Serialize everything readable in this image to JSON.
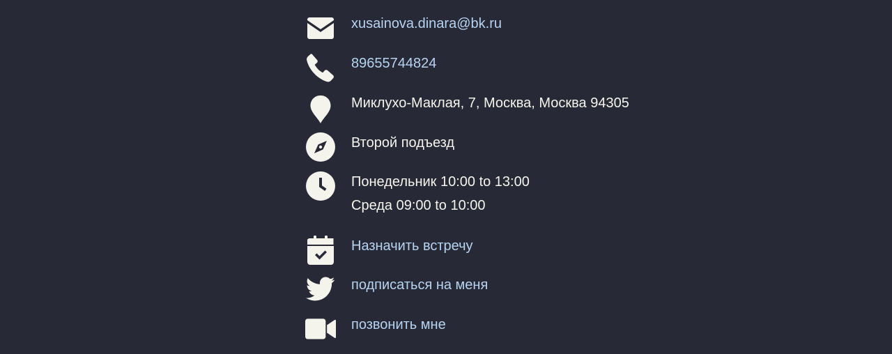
{
  "contact": {
    "email": {
      "icon": "envelope-icon",
      "value": "xusainova.dinara@bk.ru"
    },
    "phone": {
      "icon": "phone-icon",
      "value": "89655744824"
    },
    "address": {
      "icon": "map-pin-icon",
      "value": "Миклухо-Маклая, 7, Москва, Москва 94305"
    },
    "directions": {
      "icon": "compass-icon",
      "value": "Второй подъезд"
    },
    "hours": {
      "icon": "clock-icon",
      "lines": [
        "Понедельник 10:00 to 13:00",
        "Среда 09:00 to 10:00"
      ]
    },
    "appointment": {
      "icon": "calendar-check-icon",
      "label": "Назначить встречу"
    },
    "twitter": {
      "icon": "twitter-icon",
      "label": "подписаться на меня"
    },
    "video_call": {
      "icon": "video-camera-icon",
      "label": "позвонить мне"
    }
  },
  "colors": {
    "background": "#272a36",
    "text": "#f4f3ec",
    "link": "#b6d3f2",
    "icon": "#f4f3ec"
  }
}
